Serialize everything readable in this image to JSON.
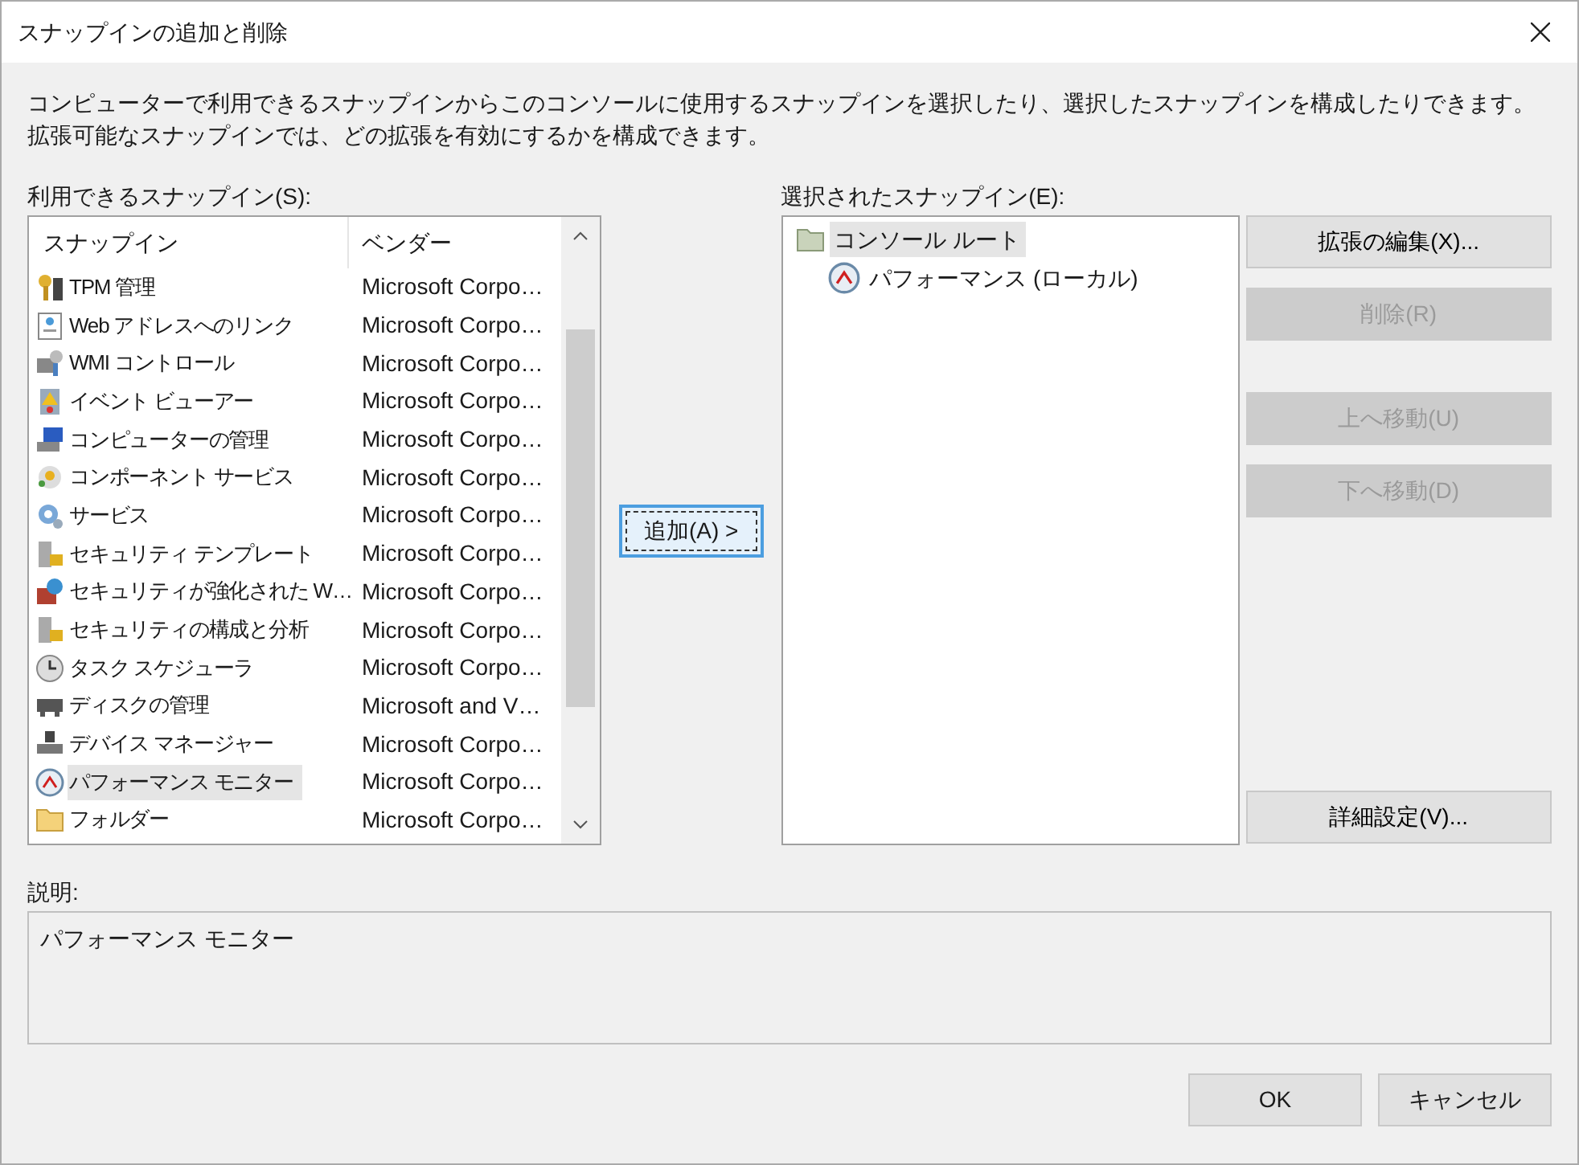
{
  "window": {
    "title": "スナップインの追加と削除"
  },
  "intro": "コンピューターで利用できるスナップインからこのコンソールに使用するスナップインを選択したり、選択したスナップインを構成したりできます。拡張可能なスナップインでは、どの拡張を有効にするかを構成できます。",
  "available": {
    "label": "利用できるスナップイン(S):",
    "columns": [
      "スナップイン",
      "ベンダー"
    ],
    "rows": [
      {
        "name": "TPM 管理",
        "vendor": "Microsoft Corpo…",
        "selected": false
      },
      {
        "name": "Web アドレスへのリンク",
        "vendor": "Microsoft Corpo…",
        "selected": false
      },
      {
        "name": "WMI コントロール",
        "vendor": "Microsoft Corpo…",
        "selected": false
      },
      {
        "name": "イベント ビューアー",
        "vendor": "Microsoft Corpo…",
        "selected": false
      },
      {
        "name": "コンピューターの管理",
        "vendor": "Microsoft Corpo…",
        "selected": false
      },
      {
        "name": "コンポーネント サービス",
        "vendor": "Microsoft Corpo…",
        "selected": false
      },
      {
        "name": "サービス",
        "vendor": "Microsoft Corpo…",
        "selected": false
      },
      {
        "name": "セキュリティ テンプレート",
        "vendor": "Microsoft Corpo…",
        "selected": false
      },
      {
        "name": "セキュリティが強化された W…",
        "vendor": "Microsoft Corpo…",
        "selected": false
      },
      {
        "name": "セキュリティの構成と分析",
        "vendor": "Microsoft Corpo…",
        "selected": false
      },
      {
        "name": "タスク スケジューラ",
        "vendor": "Microsoft Corpo…",
        "selected": false
      },
      {
        "name": "ディスクの管理",
        "vendor": "Microsoft and V…",
        "selected": false
      },
      {
        "name": "デバイス マネージャー",
        "vendor": "Microsoft Corpo…",
        "selected": false
      },
      {
        "name": "パフォーマンス モニター",
        "vendor": "Microsoft Corpo…",
        "selected": true
      },
      {
        "name": "フォルダー",
        "vendor": "Microsoft Corpo…",
        "selected": false
      }
    ]
  },
  "add_button": {
    "label": "追加(A) >",
    "focused": true
  },
  "selected_snapins": {
    "label": "選択されたスナップイン(E):",
    "items": [
      {
        "name": "コンソール ルート",
        "selected": true,
        "children": [
          {
            "name": "パフォーマンス (ローカル)",
            "selected": false
          }
        ]
      }
    ]
  },
  "side_buttons": [
    {
      "label": "拡張の編集(X)...",
      "disabled": false
    },
    {
      "label": "削除(R)",
      "disabled": true
    },
    {
      "label": "上へ移動(U)",
      "disabled": true
    },
    {
      "label": "下へ移動(D)",
      "disabled": true
    },
    {
      "label": "詳細設定(V)...",
      "disabled": false
    }
  ],
  "description": {
    "label": "説明:",
    "text": "パフォーマンス モニター"
  },
  "footer_buttons": [
    {
      "label": "OK"
    },
    {
      "label": "キャンセル"
    }
  ]
}
